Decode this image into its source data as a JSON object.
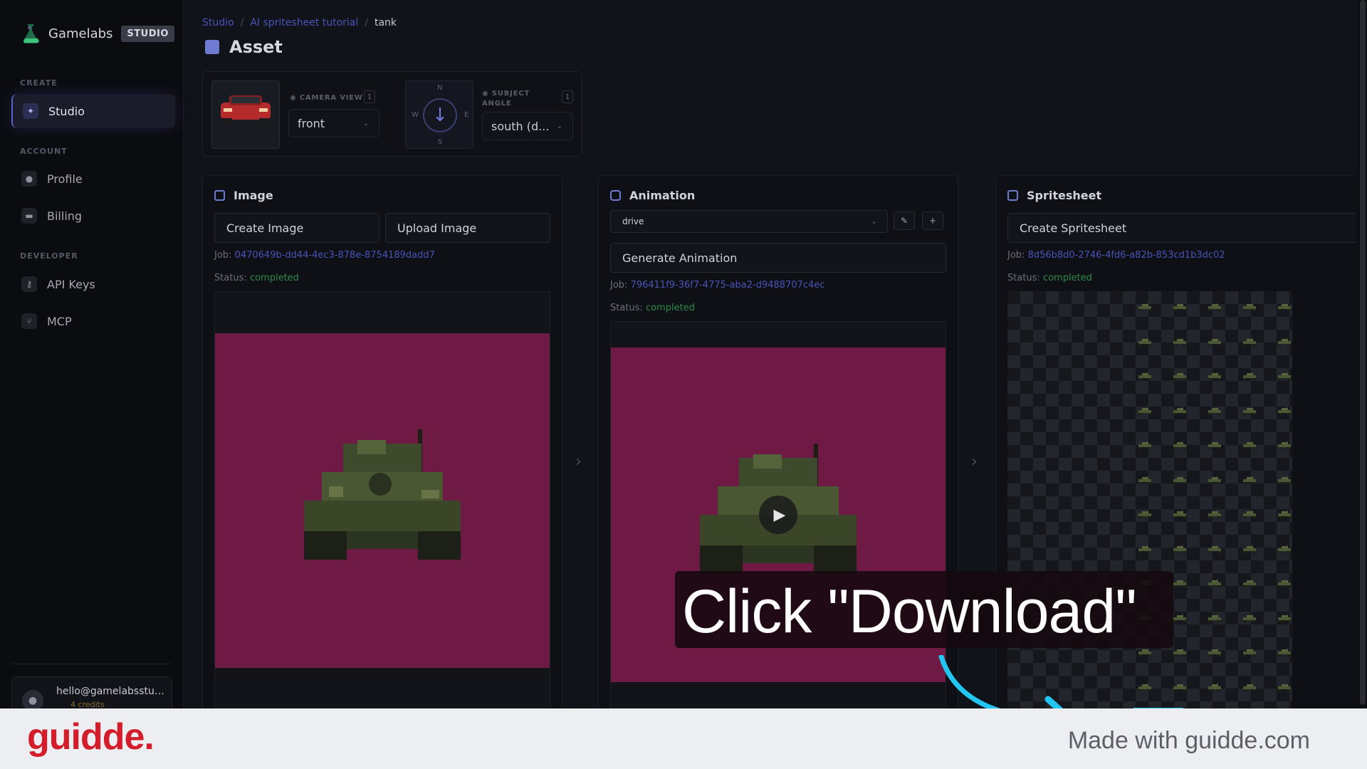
{
  "brand": {
    "name": "Gamelabs",
    "badge": "STUDIO"
  },
  "sidebar": {
    "sections": [
      {
        "label": "CREATE",
        "items": [
          {
            "label": "Studio",
            "icon": "wand-icon",
            "active": true
          }
        ]
      },
      {
        "label": "ACCOUNT",
        "items": [
          {
            "label": "Profile",
            "icon": "user-icon"
          },
          {
            "label": "Billing",
            "icon": "card-icon"
          }
        ]
      },
      {
        "label": "DEVELOPER",
        "items": [
          {
            "label": "API Keys",
            "icon": "key-icon"
          },
          {
            "label": "MCP",
            "icon": "branch-icon"
          }
        ]
      }
    ],
    "user": {
      "email": "hello@gamelabsstudio.com",
      "credits": "4 credits"
    }
  },
  "breadcrumb": {
    "root": "Studio",
    "project": "AI spritesheet tutorial",
    "current": "tank"
  },
  "page": {
    "title": "Asset"
  },
  "config": {
    "camera_view_label": "CAMERA VIEW",
    "camera_view_badge": "1",
    "camera_view_value": "front",
    "compass": {
      "n": "N",
      "s": "S",
      "e": "E",
      "w": "W"
    },
    "subject_angle_label": "SUBJECT ANGLE",
    "subject_angle_badge": "1",
    "subject_angle_value": "south (d..."
  },
  "image_panel": {
    "title": "Image",
    "create_label": "Create Image",
    "upload_label": "Upload Image",
    "job_label": "Job:",
    "job_id": "0470649b-dd44-4ec3-878e-8754189dadd7",
    "status_label": "Status:",
    "status": "completed"
  },
  "animation_panel": {
    "title": "Animation",
    "animation_select": "drive",
    "generate_label": "Generate Animation",
    "job_label": "Job:",
    "job_id": "796411f9-36f7-4775-aba2-d9488707c4ec",
    "status_label": "Status:",
    "status": "completed"
  },
  "spritesheet_panel": {
    "title": "Spritesheet",
    "create_label": "Create Spritesheet",
    "job_label": "Job:",
    "job_id": "8d56b8d0-2746-4fd6-a82b-853cd1b3dc02",
    "status_label": "Status:",
    "status": "completed"
  },
  "overlay": {
    "instruction": "Click \"Download\""
  },
  "footer": {
    "logo": "guidde.",
    "made_with": "Made with guidde.com"
  },
  "colors": {
    "accent": "#5b5fc7",
    "status_ok": "#2f8a4a",
    "preview_bg": "#6e1a45",
    "brand_red": "#d41d2b"
  }
}
